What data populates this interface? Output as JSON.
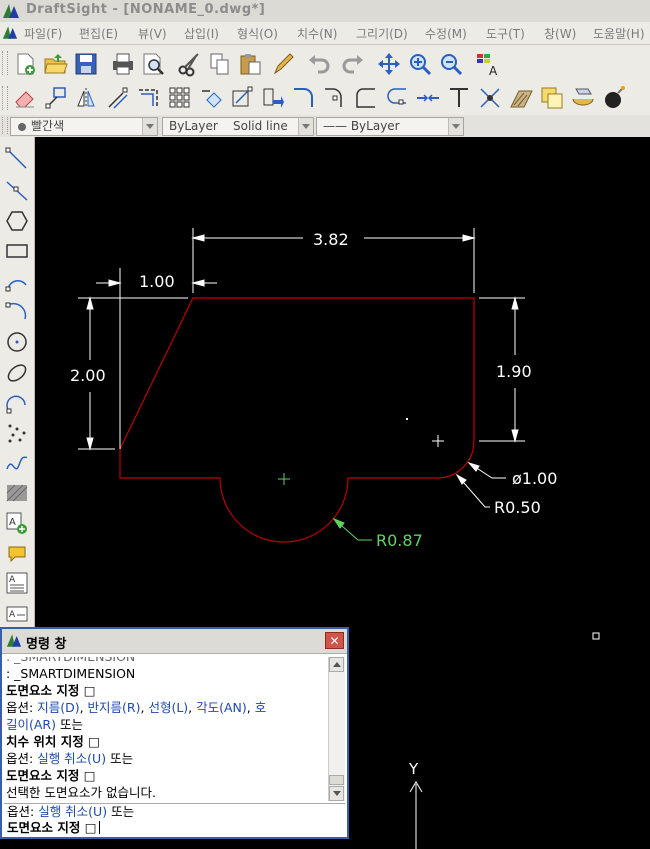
{
  "window": {
    "title": "DraftSight - [NONAME_0.dwg*]"
  },
  "menu": [
    "파일(F)",
    "편집(E)",
    "뷰(V)",
    "삽입(I)",
    "형식(O)",
    "치수(N)",
    "그리기(D)",
    "수정(M)",
    "도구(T)",
    "창(W)",
    "도움말(H)"
  ],
  "properties": {
    "color": "빨간색",
    "layer": "ByLayer",
    "linestyle": "Solid line",
    "lineweight": "—— ByLayer"
  },
  "drawing": {
    "dim_top": "3.82",
    "dim_left_offset": "1.00",
    "dim_left_height": "2.00",
    "dim_right_height": "1.90",
    "dim_diameter": "ø1.00",
    "dim_fillet": "R0.50",
    "dim_arc": "R0.87",
    "axis_y_label": "Y"
  },
  "colors": {
    "outline": "#c00000",
    "dimension": "#ffffff",
    "selected_dim": "#5fd35f",
    "canvas": "#000000"
  },
  "command_window": {
    "title": "명령 창",
    "history_top_partial": ": _SMARTDIMENSION",
    "smartdimension": ": _SMARTDIMENSION",
    "line1_label": "도면요소 지정",
    "opt_prefix": "옵션:",
    "opt_d": "지름(D)",
    "opt_r": "반지름(R)",
    "opt_l": "선형(L)",
    "opt_an": "각도(AN)",
    "opt_ar_a": "호",
    "opt_ar_b": "길이(AR)",
    "opt_or": "또는",
    "place_label": "치수 위치 지정",
    "opt_u": "실행 취소(U)",
    "no_selection": "선택한 도면요소가 없습니다.",
    "input_line1_prefix": "옵션:",
    "input_line1_opt": "실행 취소(U)",
    "input_line1_suffix": "또는",
    "input_line2": "도면요소 지정"
  }
}
